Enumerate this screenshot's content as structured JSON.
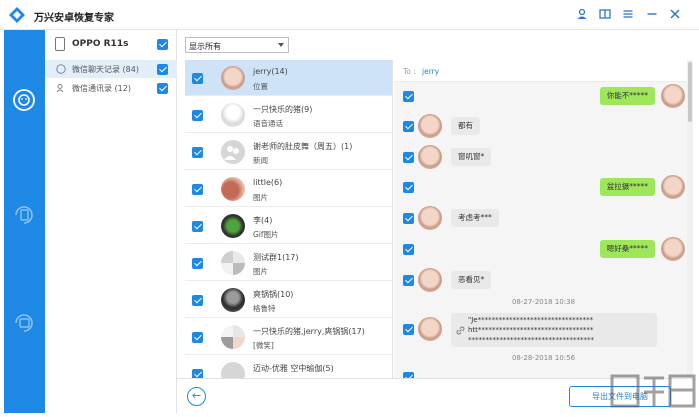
{
  "app": {
    "title": "万兴安卓恢复专家"
  },
  "device": {
    "name": "OPPO R11s"
  },
  "categories": [
    {
      "label": "微信聊天记录 (84)"
    },
    {
      "label": "微信通讯录 (12)"
    }
  ],
  "filter": {
    "value": "显示所有"
  },
  "contacts": [
    {
      "name": "jerry(14)",
      "sub": "位置"
    },
    {
      "name": "一只快乐的猪(9)",
      "sub": "语音通话"
    },
    {
      "name": "谢老师的肚皮舞（周五）(1)",
      "sub": "新闻"
    },
    {
      "name": "little(6)",
      "sub": "图片"
    },
    {
      "name": "李(4)",
      "sub": "Gif图片"
    },
    {
      "name": "测试群1(17)",
      "sub": "图片"
    },
    {
      "name": "爽锅锅(10)",
      "sub": "格鲁特"
    },
    {
      "name": "一只快乐的猪,jerry,爽锅锅(17)",
      "sub": "[微笑]"
    },
    {
      "name": "迈动-优雅 空中瑜伽(5)",
      "sub": ""
    }
  ],
  "chat": {
    "to_label": "To :",
    "to_name": "jerry",
    "messages": [
      {
        "side": "right",
        "text": "你能不*****"
      },
      {
        "side": "left",
        "text": "都有"
      },
      {
        "side": "left",
        "text": "窗叽窗*"
      },
      {
        "side": "right",
        "text": "盆拉摄*****"
      },
      {
        "side": "left",
        "text": "考虑考***"
      },
      {
        "side": "right",
        "text": "嗯好桑*****"
      },
      {
        "side": "left",
        "text": "恶看见*"
      }
    ],
    "timestamp1": "08-27-2018 10:38",
    "link_lines": [
      "\"Je*********************************",
      "htt*********************************",
      "************************************"
    ],
    "timestamp2": "08-28-2018 10:56"
  },
  "bottom": {
    "export_label": "导出文件到电脑"
  },
  "colors": {
    "accent": "#1e88e5",
    "selected_row": "#cfe3f8",
    "bubble_right": "#9ee75a",
    "bubble_left": "#e9e9e9"
  }
}
